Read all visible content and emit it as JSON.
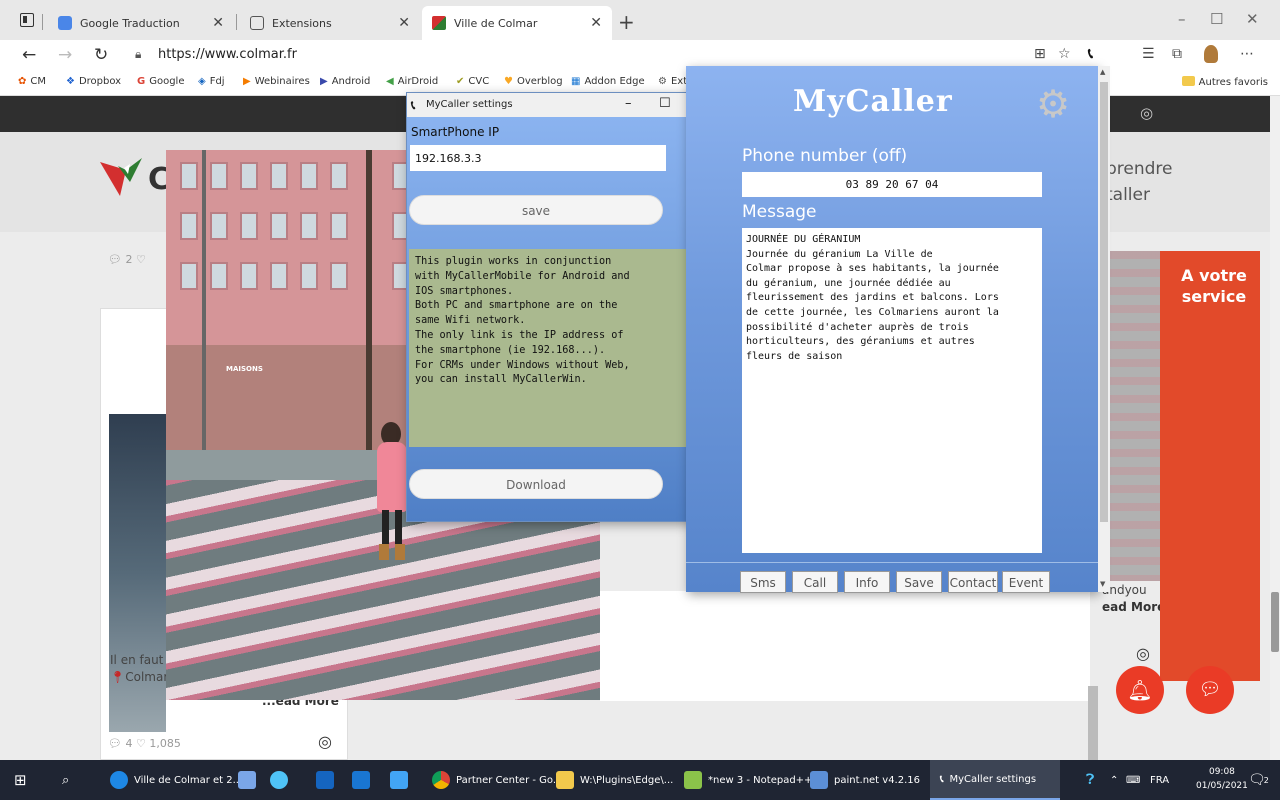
{
  "tabs": [
    {
      "label": "Google Traduction",
      "active": false
    },
    {
      "label": "Extensions",
      "active": false
    },
    {
      "label": "Ville de Colmar",
      "active": true
    }
  ],
  "address": {
    "url": "https://www.colmar.fr"
  },
  "bookmarks": [
    "CM",
    "Dropbox",
    "Google",
    "Fdj",
    "Webinaires",
    "Android",
    "AirDroid",
    "CVC",
    "Overblog",
    "Addon Edge",
    "Ext"
  ],
  "bookmarks_more": "Autres favoris",
  "page": {
    "logo_text": "Co",
    "hero_right": [
      "prendre",
      "taller"
    ],
    "left_meta": "2 ♡",
    "left_caption_1": "Il en faut p",
    "left_caption_2": "Colmar",
    "left_readmore": "...ead More",
    "bottom_meta": "4 ♡ 1,085",
    "right_text_1": "andyou",
    "right_text_2": "ead More",
    "promo": "A votre service",
    "shop_sign": "MAISONS"
  },
  "settings": {
    "title": "MyCaller settings",
    "ip_label": "SmartPhone IP",
    "ip_value": "192.168.3.3",
    "save_label": "save",
    "info_text": "This plugin works in conjunction\nwith MyCallerMobile for Android and\nIOS smartphones.\nBoth PC and smartphone are on the\nsame Wifi network.\nThe only link is the IP address of\nthe smartphone (ie 192.168...).\nFor CRMs under Windows without Web,\nyou can install MyCallerWin.",
    "download_label": "Download"
  },
  "mycaller": {
    "title": "MyCaller",
    "phone_label": "Phone number (off)",
    "phone_value": "03 89 20 67 04",
    "message_label": "Message",
    "message_text": "JOURNÉE DU GÉRANIUM\nJournée du géranium   La Ville de\nColmar propose à ses habitants, la journée\ndu géranium, une journée dédiée au\nfleurissement des jardins et balcons. Lors\nde cette journée, les Colmariens auront la\npossibilité d'acheter auprès de trois\nhorticulteurs, des géraniums et autres\nfleurs de saison",
    "buttons": [
      "Sms",
      "Call",
      "Info",
      "Save",
      "Contact",
      "Event"
    ]
  },
  "taskbar": {
    "items": [
      "Ville de Colmar et 2...",
      "Partner Center - Go...",
      "W:\\Plugins\\Edge\\...",
      "*new 3 - Notepad++",
      "paint.net v4.2.16",
      "MyCaller settings"
    ],
    "lang": "FRA",
    "time": "09:08",
    "date": "01/05/2021",
    "notif_count": "2"
  },
  "colors": {
    "accent_blue": "#6f99dc",
    "info_green": "#aab98f",
    "colmar_red": "#e24a2a",
    "taskbar": "#1f2533"
  }
}
